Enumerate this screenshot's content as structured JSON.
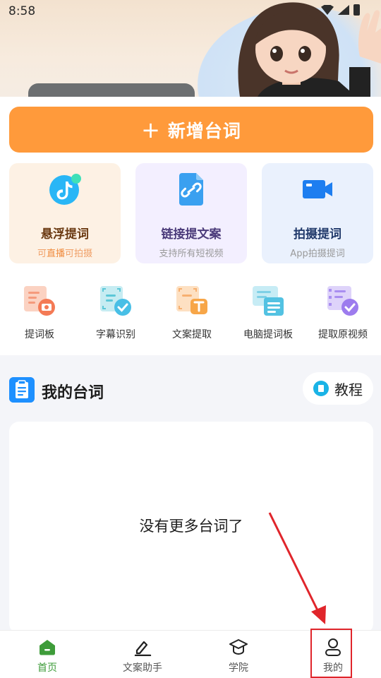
{
  "status_bar": {
    "time": "8:58"
  },
  "add_button": {
    "label": "新增台词",
    "icon": "plus-icon"
  },
  "features": [
    {
      "title": "悬浮提词",
      "sub_prefix": "可",
      "sub_highlight": "直播",
      "sub_suffix": "可拍摄",
      "icon": "tiktok-icon"
    },
    {
      "title": "链接提文案",
      "sub": "支持所有短视频",
      "icon": "link-icon"
    },
    {
      "title": "拍摄提词",
      "sub": "App拍摄提词",
      "icon": "video-camera-icon"
    }
  ],
  "tools": [
    {
      "label": "提词板",
      "icon": "teleprompter-board-icon"
    },
    {
      "label": "字幕识别",
      "icon": "subtitle-recognition-icon"
    },
    {
      "label": "文案提取",
      "icon": "text-extract-icon"
    },
    {
      "label": "电脑提词板",
      "icon": "pc-teleprompter-icon"
    },
    {
      "label": "提取原视频",
      "icon": "extract-video-icon"
    }
  ],
  "my_lines": {
    "title": "我的台词",
    "tutorial_label": "教程",
    "empty_text": "没有更多台词了"
  },
  "tabbar": [
    {
      "label": "首页",
      "icon": "home-icon",
      "active": true
    },
    {
      "label": "文案助手",
      "icon": "edit-icon",
      "active": false
    },
    {
      "label": "学院",
      "icon": "graduation-cap-icon",
      "active": false
    },
    {
      "label": "我的",
      "icon": "user-icon",
      "active": false
    }
  ],
  "colors": {
    "accent_orange": "#ff9a3b",
    "tab_active_green": "#3e9c3a",
    "annotation_red": "#e0252b"
  }
}
